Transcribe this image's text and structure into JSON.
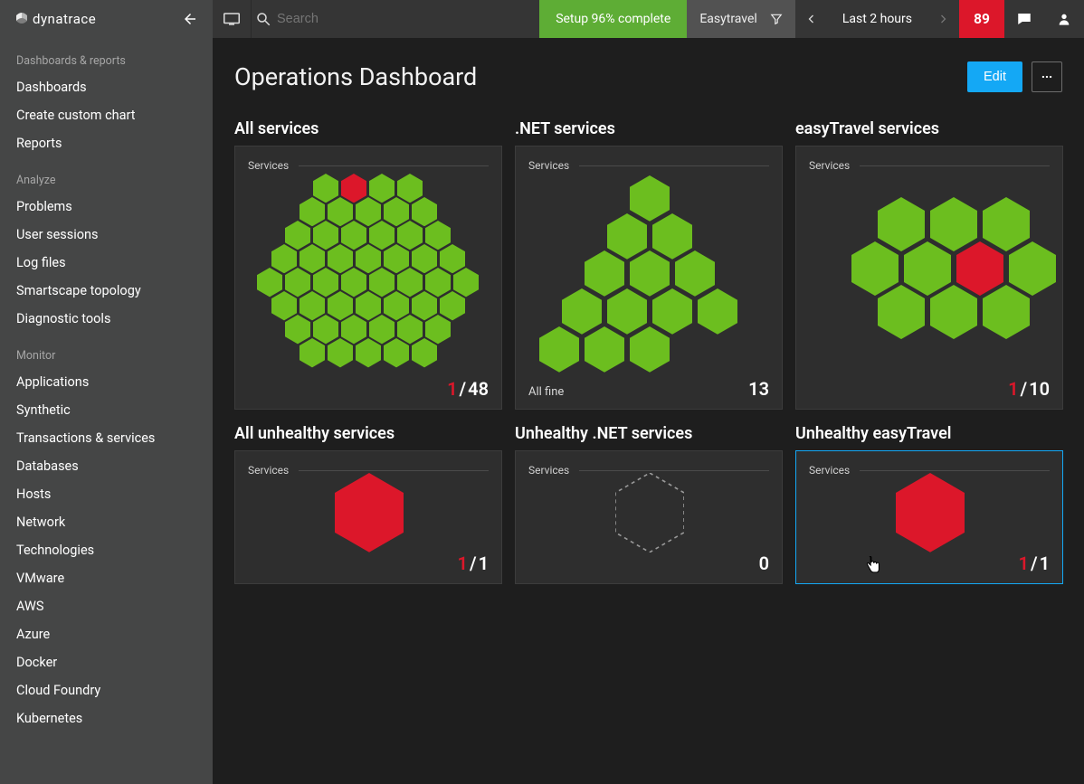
{
  "brand": "dynatrace",
  "topbar": {
    "search_placeholder": "Search",
    "setup_label": "Setup 96% complete",
    "scope_label": "Easytravel",
    "timerange_label": "Last 2 hours",
    "alert_count": "89"
  },
  "sidebar": {
    "sections": [
      {
        "label": "Dashboards & reports",
        "items": [
          "Dashboards",
          "Create custom chart",
          "Reports"
        ]
      },
      {
        "label": "Analyze",
        "items": [
          "Problems",
          "User sessions",
          "Log files",
          "Smartscape topology",
          "Diagnostic tools"
        ]
      },
      {
        "label": "Monitor",
        "items": [
          "Applications",
          "Synthetic",
          "Transactions & services",
          "Databases",
          "Hosts",
          "Network",
          "Technologies",
          "VMware",
          "AWS",
          "Azure",
          "Docker",
          "Cloud Foundry",
          "Kubernetes"
        ]
      }
    ]
  },
  "page": {
    "title": "Operations Dashboard",
    "edit_label": "Edit"
  },
  "tiles": {
    "services_label": "Services",
    "all_fine_label": "All fine",
    "t0": {
      "title": "All services",
      "problem": "1",
      "total": "48"
    },
    "t1": {
      "title": ".NET services",
      "problem": "",
      "total": "13"
    },
    "t2": {
      "title": "easyTravel services",
      "problem": "1",
      "total": "10"
    },
    "t3": {
      "title": "All unhealthy services",
      "problem": "1",
      "total": "1"
    },
    "t4": {
      "title": "Unhealthy .NET services",
      "problem": "",
      "total": "0"
    },
    "t5": {
      "title": "Unhealthy easyTravel",
      "problem": "1",
      "total": "1"
    }
  },
  "colors": {
    "green": "#6cbe1f",
    "red": "#dc172a"
  }
}
